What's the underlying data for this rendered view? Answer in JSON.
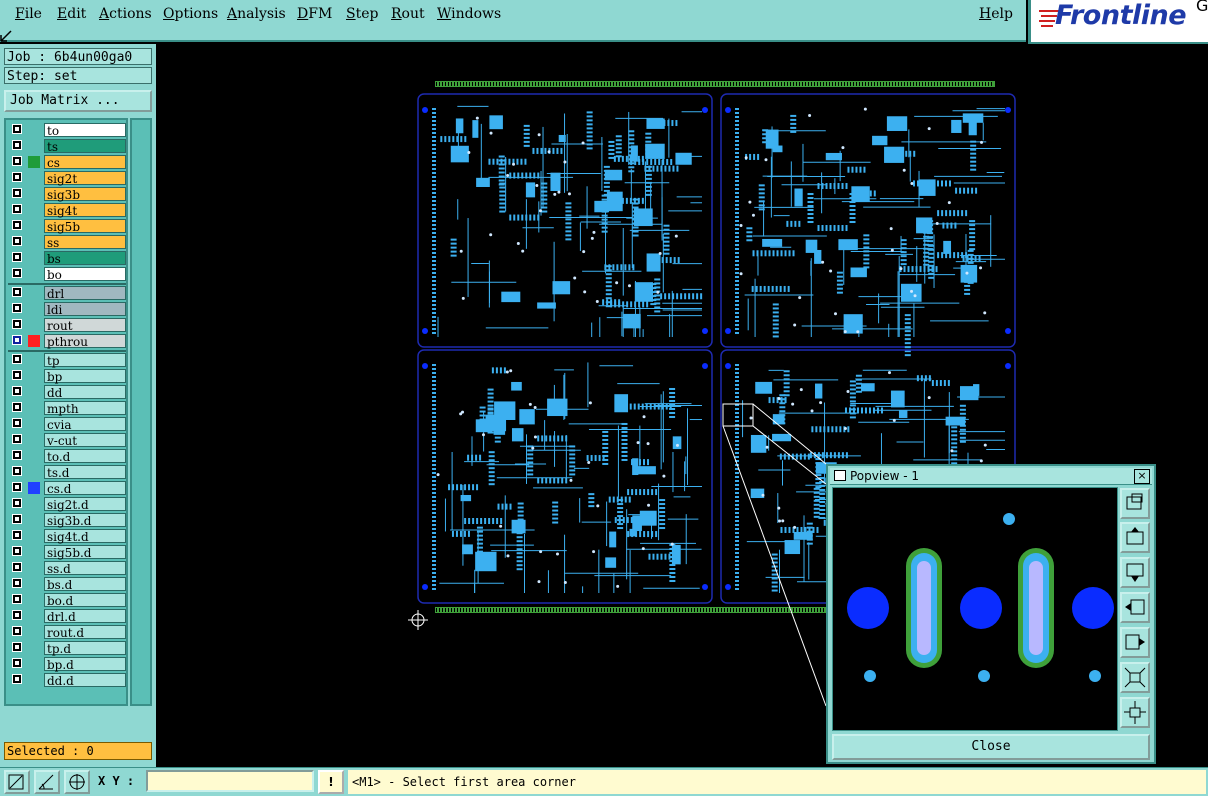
{
  "menu": {
    "items": [
      "File",
      "Edit",
      "Actions",
      "Options",
      "Analysis",
      "DFM",
      "Step",
      "Rout",
      "Windows"
    ],
    "help": "Help"
  },
  "logo": {
    "text": "Frontline",
    "suffix": "G"
  },
  "job": {
    "job_label": "Job : 6b4un00ga0",
    "step_label": "Step: set",
    "matrix_button": "Job Matrix ..."
  },
  "layers": [
    {
      "name": "to",
      "color": "#ffffff",
      "dot": ""
    },
    {
      "name": "ts",
      "color": "#1f9c7a",
      "dot": ""
    },
    {
      "name": "cs",
      "color": "#ffbf40",
      "dot": "#1f9c3a"
    },
    {
      "name": "sig2t",
      "color": "#ffbf40",
      "dot": ""
    },
    {
      "name": "sig3b",
      "color": "#ffbf40",
      "dot": ""
    },
    {
      "name": "sig4t",
      "color": "#ffbf40",
      "dot": ""
    },
    {
      "name": "sig5b",
      "color": "#ffbf40",
      "dot": ""
    },
    {
      "name": "ss",
      "color": "#ffbf40",
      "dot": ""
    },
    {
      "name": "bs",
      "color": "#1f9c7a",
      "dot": ""
    },
    {
      "name": "bo",
      "color": "#ffffff",
      "dot": ""
    },
    {
      "name": "drl",
      "color": "#a0b8c0",
      "dot": ""
    },
    {
      "name": "ldi",
      "color": "#a0b8c0",
      "dot": ""
    },
    {
      "name": "rout",
      "color": "#d0d8d8",
      "dot": ""
    },
    {
      "name": "pthrou",
      "color": "#d0d8d8",
      "dot": "#ff2020"
    },
    {
      "name": "tp",
      "color": "#a8e4de",
      "dot": ""
    },
    {
      "name": "bp",
      "color": "#a8e4de",
      "dot": ""
    },
    {
      "name": "dd",
      "color": "#a8e4de",
      "dot": ""
    },
    {
      "name": "mpth",
      "color": "#a8e4de",
      "dot": ""
    },
    {
      "name": "cvia",
      "color": "#a8e4de",
      "dot": ""
    },
    {
      "name": "v-cut",
      "color": "#a8e4de",
      "dot": ""
    },
    {
      "name": "to.d",
      "color": "#a8e4de",
      "dot": ""
    },
    {
      "name": "ts.d",
      "color": "#a8e4de",
      "dot": ""
    },
    {
      "name": "cs.d",
      "color": "#a8e4de",
      "dot": "#2040ff"
    },
    {
      "name": "sig2t.d",
      "color": "#a8e4de",
      "dot": ""
    },
    {
      "name": "sig3b.d",
      "color": "#a8e4de",
      "dot": ""
    },
    {
      "name": "sig4t.d",
      "color": "#a8e4de",
      "dot": ""
    },
    {
      "name": "sig5b.d",
      "color": "#a8e4de",
      "dot": ""
    },
    {
      "name": "ss.d",
      "color": "#a8e4de",
      "dot": ""
    },
    {
      "name": "bs.d",
      "color": "#a8e4de",
      "dot": ""
    },
    {
      "name": "bo.d",
      "color": "#a8e4de",
      "dot": ""
    },
    {
      "name": "drl.d",
      "color": "#a8e4de",
      "dot": ""
    },
    {
      "name": "rout.d",
      "color": "#a8e4de",
      "dot": ""
    },
    {
      "name": "tp.d",
      "color": "#a8e4de",
      "dot": ""
    },
    {
      "name": "bp.d",
      "color": "#a8e4de",
      "dot": ""
    },
    {
      "name": "dd.d",
      "color": "#a8e4de",
      "dot": ""
    }
  ],
  "selected": "Selected : 0",
  "status": {
    "xy_label": "X Y :",
    "xy_value": "",
    "alert": "!",
    "message": "<M1> - Select first area corner"
  },
  "popview": {
    "title": "Popview - 1",
    "close_x": "×",
    "close_button": "Close"
  },
  "colors": {
    "panel": "#8fd8d2",
    "board_outline": "#1e2ab0",
    "copper": "#3cb0f0",
    "pad_green": "#3fa03a",
    "pad_blue": "#0a2cff"
  }
}
